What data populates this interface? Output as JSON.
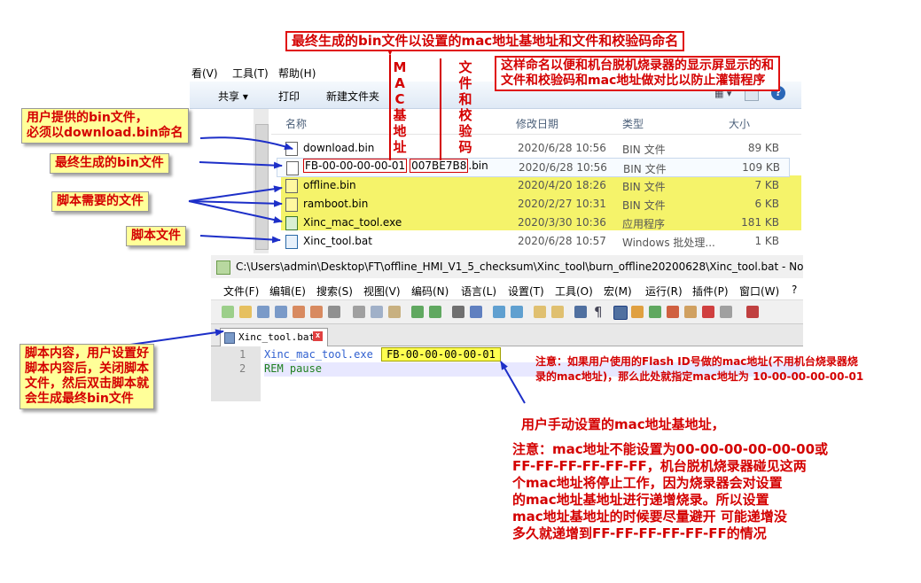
{
  "explorer": {
    "menu": {
      "view": "看(V)",
      "tools": "工具(T)",
      "help": "帮助(H)"
    },
    "toolbar": {
      "share": "共享 ▾",
      "print": "打印",
      "new_folder": "新建文件夹"
    },
    "columns": {
      "name": "名称",
      "date": "修改日期",
      "type": "类型",
      "size": "大小"
    },
    "files": [
      {
        "icon": "bin",
        "name": "download.bin",
        "date": "2020/6/28 10:56",
        "type": "BIN 文件",
        "size": "89 KB"
      },
      {
        "icon": "bin",
        "name_prefix": "FB-00-00-00-00-01",
        "name_crc": "007BE7B8",
        "name_suffix": ".bin",
        "date": "2020/6/28 10:56",
        "type": "BIN 文件",
        "size": "109 KB"
      },
      {
        "icon": "bin",
        "name": "offline.bin",
        "date": "2020/4/20 18:26",
        "type": "BIN 文件",
        "size": "7 KB"
      },
      {
        "icon": "bin",
        "name": "ramboot.bin",
        "date": "2020/2/27 10:31",
        "type": "BIN 文件",
        "size": "6 KB"
      },
      {
        "icon": "exe",
        "name": "Xinc_mac_tool.exe",
        "date": "2020/3/30 10:36",
        "type": "应用程序",
        "size": "181 KB"
      },
      {
        "icon": "bat",
        "name": "Xinc_tool.bat",
        "date": "2020/6/28 10:57",
        "type": "Windows 批处理...",
        "size": "1 KB"
      }
    ]
  },
  "notepad": {
    "title": "C:\\Users\\admin\\Desktop\\FT\\offline_HMI_V1_5_checksum\\Xinc_tool\\burn_offline20200628\\Xinc_tool.bat - Note",
    "menu": [
      "文件(F)",
      "编辑(E)",
      "搜索(S)",
      "视图(V)",
      "编码(N)",
      "语言(L)",
      "设置(T)",
      "工具(O)",
      "宏(M)",
      "运行(R)",
      "插件(P)",
      "窗口(W)",
      "?"
    ],
    "tab": "Xinc_tool.bat",
    "lines": [
      {
        "num": "1",
        "cmd": "Xinc_mac_tool.exe",
        "arg": "FB-00-00-00-00-01"
      },
      {
        "num": "2",
        "text": "REM pause"
      }
    ]
  },
  "annotations": {
    "top_title": "最终生成的bin文件以设置的mac地址基地址和文件和校验码命名",
    "naming_note_1": "这样命名以便和机台脱机烧录器的显示屏显示的和",
    "naming_note_2": "文件和校验码和mac地址做对比以防止灌错程序",
    "mac_vertical": [
      "M",
      "A",
      "C",
      "基",
      "地",
      "址"
    ],
    "checksum_vertical": [
      "文",
      "件",
      "和",
      "校",
      "验",
      "码"
    ],
    "user_bin_1": "用户提供的bin文件，",
    "user_bin_2": "必须以download.bin命名",
    "final_bin": "最终生成的bin文件",
    "script_needed": "脚本需要的文件",
    "script_file": "脚本文件",
    "script_content": [
      "脚本内容，用户设置好",
      "脚本内容后，关闭脚本",
      "文件，然后双击脚本就",
      "会生成最终bin文件"
    ],
    "flash_note_1": "注意：如果用户使用的Flash ID号做的mac地址(不用机台烧录器烧",
    "flash_note_2": "录的mac地址)，那么此处就指定mac地址为 10-00-00-00-00-01",
    "manual_mac": "用户手动设置的mac地址基地址，",
    "warning_lines": [
      "注意：mac地址不能设置为00-00-00-00-00-00或",
      "FF-FF-FF-FF-FF-FF，机台脱机烧录器碰见这两",
      "个mac地址将停止工作，因为烧录器会对设置",
      "的mac地址基地址进行递增烧录。所以设置",
      "mac地址基地址的时候要尽量避开 可能递增没",
      "多久就递增到FF-FF-FF-FF-FF-FF的情况"
    ]
  }
}
